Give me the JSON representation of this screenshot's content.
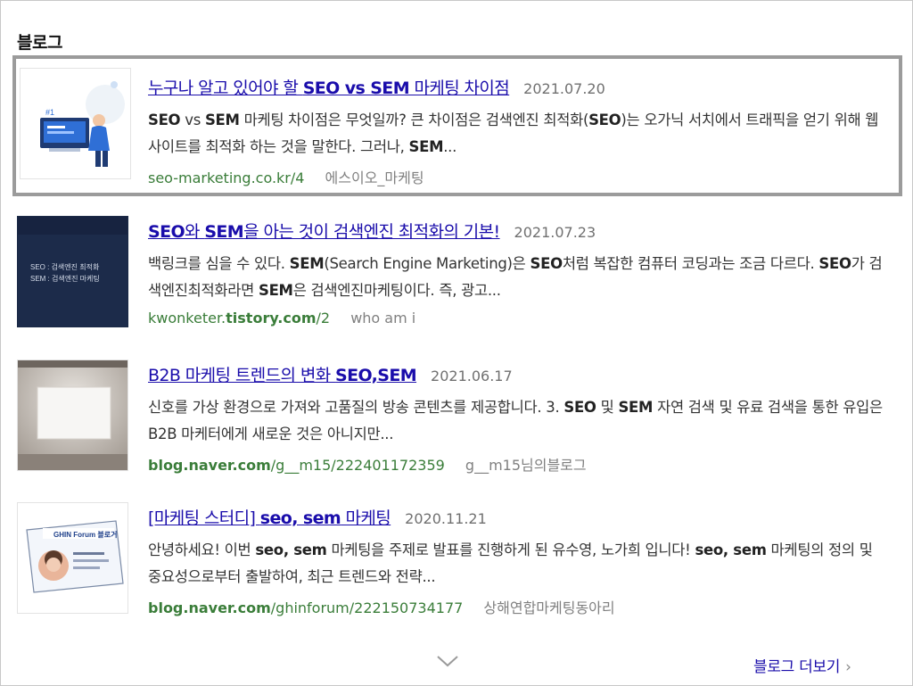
{
  "section": {
    "title": "블로그"
  },
  "results": [
    {
      "title_pre": "누구나 알고 있어야 할 ",
      "title_bold": "SEO vs SEM",
      "title_post": " 마케팅 차이점",
      "date": "2021.07.20",
      "desc": [
        {
          "b": true,
          "t": "SEO"
        },
        {
          "b": false,
          "t": " vs "
        },
        {
          "b": true,
          "t": "SEM"
        },
        {
          "b": false,
          "t": " 마케팅 차이점은 무엇일까? 큰 차이점은 검색엔진 최적화("
        },
        {
          "b": true,
          "t": "SEO"
        },
        {
          "b": false,
          "t": ")는 오가닉 서치에서 트래픽을 얻기 위해 웹사이트를 최적화 하는 것을 말한다. 그러나, "
        },
        {
          "b": true,
          "t": "SEM"
        },
        {
          "b": false,
          "t": "..."
        }
      ],
      "url_pre": "seo-marketing.co.kr/4",
      "url_bold": "",
      "url_post": "",
      "author": "에스이오_마케팅"
    },
    {
      "title_pre": "",
      "title_bold": "SEO",
      "title_post": "와 ",
      "title_bold2": "SEM",
      "title_post2": "을 아는 것이 검색엔진 최적화의 기본!",
      "date": "2021.07.23",
      "desc": [
        {
          "b": false,
          "t": "백링크를 심을 수 있다. "
        },
        {
          "b": true,
          "t": "SEM"
        },
        {
          "b": false,
          "t": "(Search Engine Marketing)은 "
        },
        {
          "b": true,
          "t": "SEO"
        },
        {
          "b": false,
          "t": "처럼 복잡한 컴퓨터 코딩과는 조금 다르다. "
        },
        {
          "b": true,
          "t": "SEO"
        },
        {
          "b": false,
          "t": "가 검색엔진최적화라면 "
        },
        {
          "b": true,
          "t": "SEM"
        },
        {
          "b": false,
          "t": "은 검색엔진마케팅이다. 즉, 광고..."
        }
      ],
      "url_pre": "kwonketer.",
      "url_bold": "tistory.com",
      "url_post": "/2",
      "author": "who am i",
      "thumb_text": [
        "SEO : 검색엔진 최적화",
        "SEM : 검색엔진 마케팅"
      ]
    },
    {
      "title_pre": "B2B 마케팅 트렌드의 변화 ",
      "title_bold": "SEO,SEM",
      "title_post": "",
      "date": "2021.06.17",
      "desc": [
        {
          "b": false,
          "t": "신호를 가상 환경으로 가져와 고품질의 방송 콘텐츠를 제공합니다.  3. "
        },
        {
          "b": true,
          "t": "SEO"
        },
        {
          "b": false,
          "t": " 및 "
        },
        {
          "b": true,
          "t": "SEM"
        },
        {
          "b": false,
          "t": " 자연 검색 및 유료 검색을 통한 유입은 B2B 마케터에게 새로운 것은 아니지만..."
        }
      ],
      "url_pre": "",
      "url_bold": "blog.naver.com",
      "url_post": "/g__m15/222401172359",
      "author": "g__m15님의블로그"
    },
    {
      "title_pre": "[마케팅 스터디] ",
      "title_bold": "seo, sem",
      "title_post": " 마케팅",
      "date": "2020.11.21",
      "desc": [
        {
          "b": false,
          "t": " 안녕하세요! 이번 "
        },
        {
          "b": true,
          "t": "seo, sem"
        },
        {
          "b": false,
          "t": " 마케팅을 주제로 발표를 진행하게 된 유수영, 노가희 입니다! "
        },
        {
          "b": true,
          "t": "seo, sem"
        },
        {
          "b": false,
          "t": " 마케팅의 정의 및 중요성으로부터 출발하여, 최근 트렌드와 전략..."
        }
      ],
      "url_pre": "",
      "url_bold": "blog.naver.com",
      "url_post": "/ghinforum/222150734177",
      "author": "상해연합마케팅동아리",
      "thumb_text": [
        "GHIN Forum",
        "블로거"
      ]
    }
  ],
  "footer": {
    "more_label": "블로그 더보기",
    "more_chevron": "›"
  },
  "colors": {
    "link": "#1a0dab",
    "url": "#3a7d39",
    "highlight_border": "#9b9b9b"
  }
}
